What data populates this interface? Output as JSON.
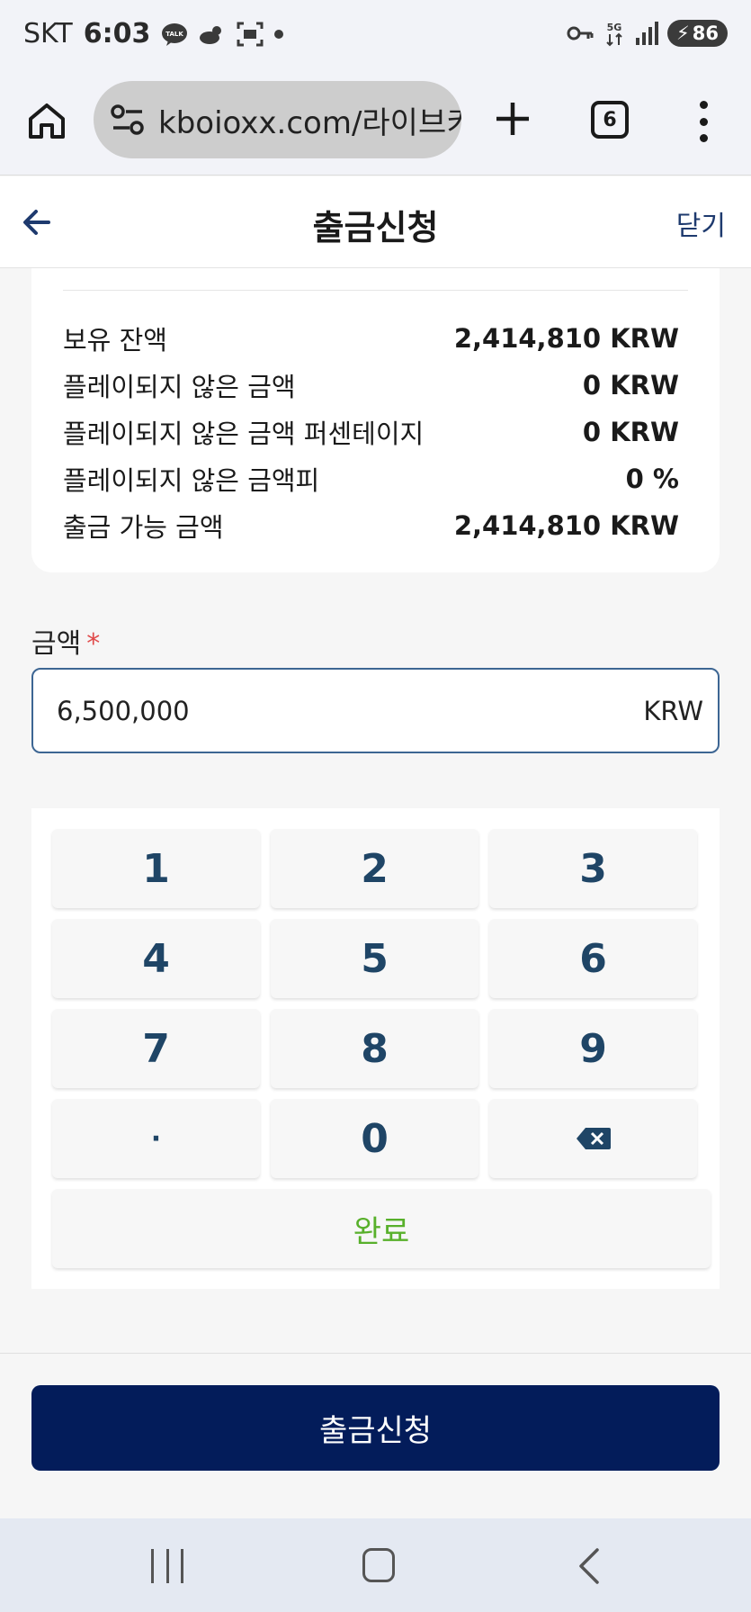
{
  "status_bar": {
    "carrier": "SKT",
    "time": "6:03",
    "talk_label": "TALK",
    "network": "5G",
    "battery": "86"
  },
  "browser": {
    "url": "kboioxx.com/라이브키",
    "tab_count": "6"
  },
  "header": {
    "title": "출금신청",
    "close_label": "닫기"
  },
  "balance": {
    "rows": [
      {
        "label": "보유 잔액",
        "value": "2,414,810 KRW"
      },
      {
        "label": "플레이되지 않은 금액",
        "value": "0 KRW"
      },
      {
        "label": "플레이되지 않은 금액 퍼센테이지",
        "value": "0 KRW"
      },
      {
        "label": "플레이되지 않은 금액피",
        "value": "0 %"
      },
      {
        "label": "출금 가능 금액",
        "value": "2,414,810 KRW"
      }
    ]
  },
  "amount": {
    "label": "금액",
    "required_mark": "*",
    "value": "6,500,000",
    "unit": "KRW"
  },
  "keypad": {
    "keys": [
      "1",
      "2",
      "3",
      "4",
      "5",
      "6",
      "7",
      "8",
      "9",
      "·",
      "0"
    ],
    "done_label": "완료"
  },
  "submit": {
    "label": "출금신청"
  },
  "colors": {
    "primary": "#031c5a",
    "key_text": "#1f4566",
    "done_text": "#58b02b",
    "required": "#e04b4b"
  }
}
